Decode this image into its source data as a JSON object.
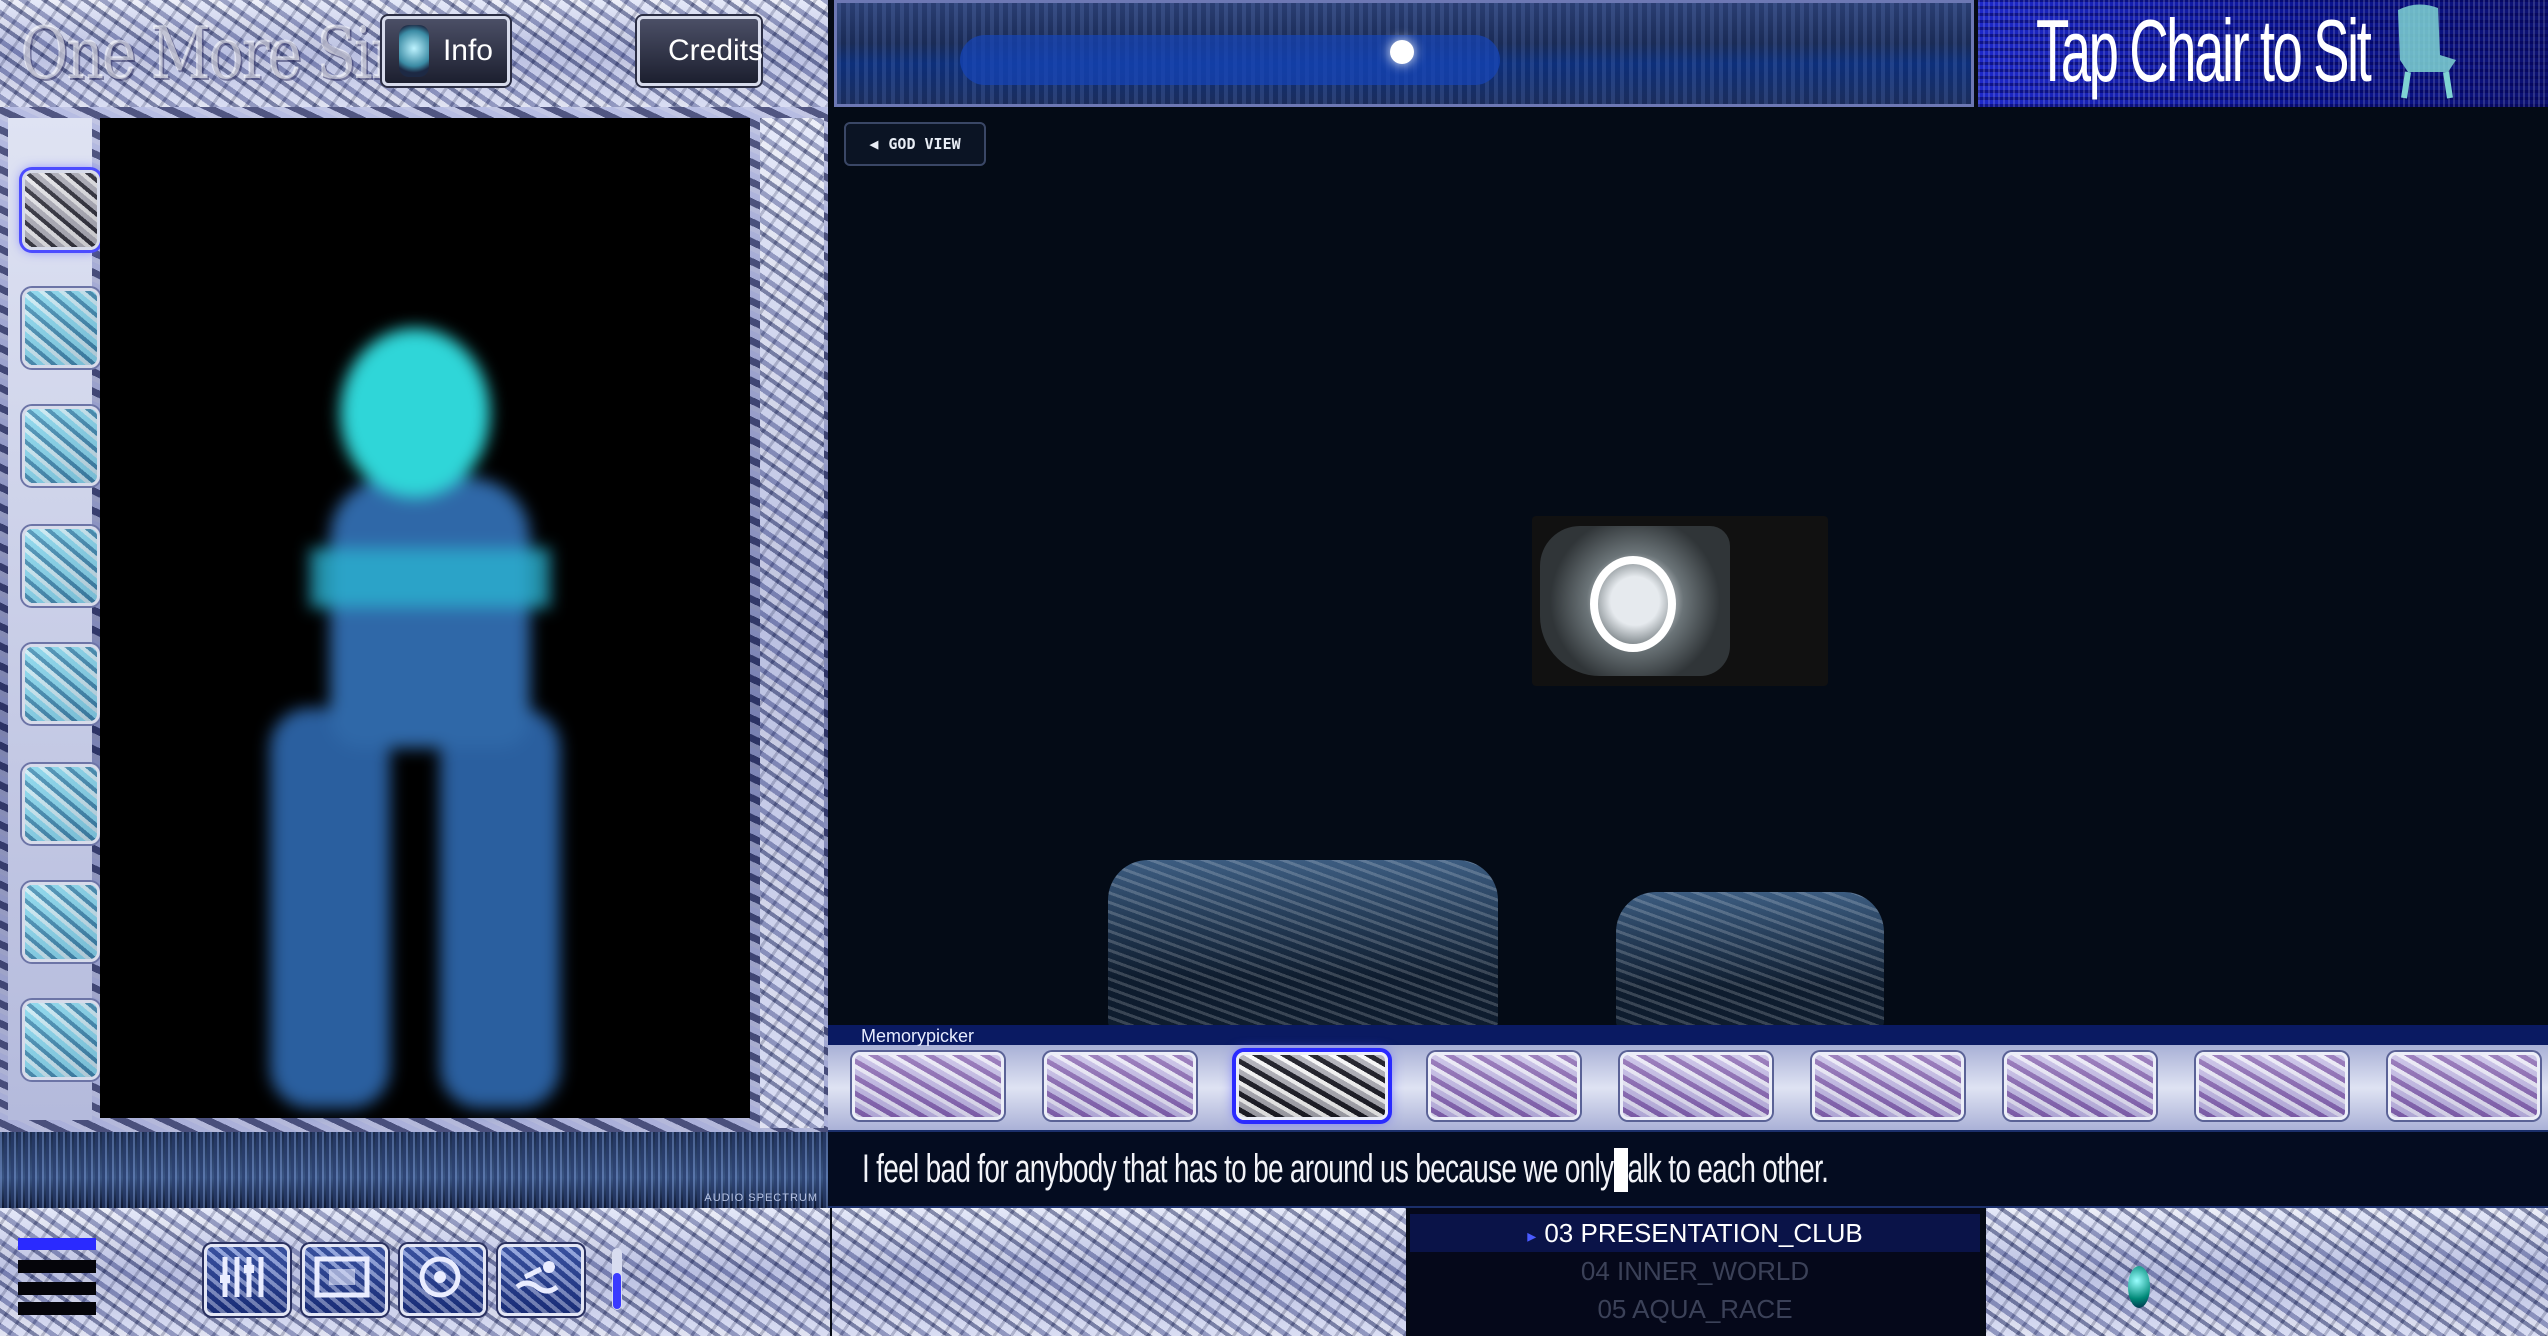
{
  "app": {
    "title": "One More Sim"
  },
  "header": {
    "info_label": "Info",
    "credits_label": "Credits",
    "hint": "Tap Chair to Sit"
  },
  "left_panel": {
    "tool_count": 8,
    "active_tool_index": 0,
    "audio_label": "AUDIO SPECTRUM"
  },
  "scene": {
    "god_view_label": "GOD VIEW",
    "god_view_icon": "triangle-left-icon"
  },
  "memorypicker": {
    "label": "Memorypicker",
    "slot_count": 9,
    "selected_index": 2
  },
  "dialogue": {
    "text": "I feel bad for anybody that has to be around us because we only talk to each other."
  },
  "footer": {
    "menu_icon": "hamburger-menu-icon",
    "controls": [
      "equalizer-icon",
      "film-icon",
      "target-icon",
      "swim-icon"
    ],
    "volume_level": 0.6,
    "playlist": [
      {
        "label": "03 PRESENTATION_CLUB",
        "current": true
      },
      {
        "label": "04 INNER_WORLD",
        "current": false
      },
      {
        "label": "05 AQUA_RACE",
        "current": false
      }
    ]
  },
  "colors": {
    "background": "#050a14",
    "accent": "#2a2aff",
    "hint_banner": "#1d28c8",
    "avatar": "#2fd6d8"
  }
}
